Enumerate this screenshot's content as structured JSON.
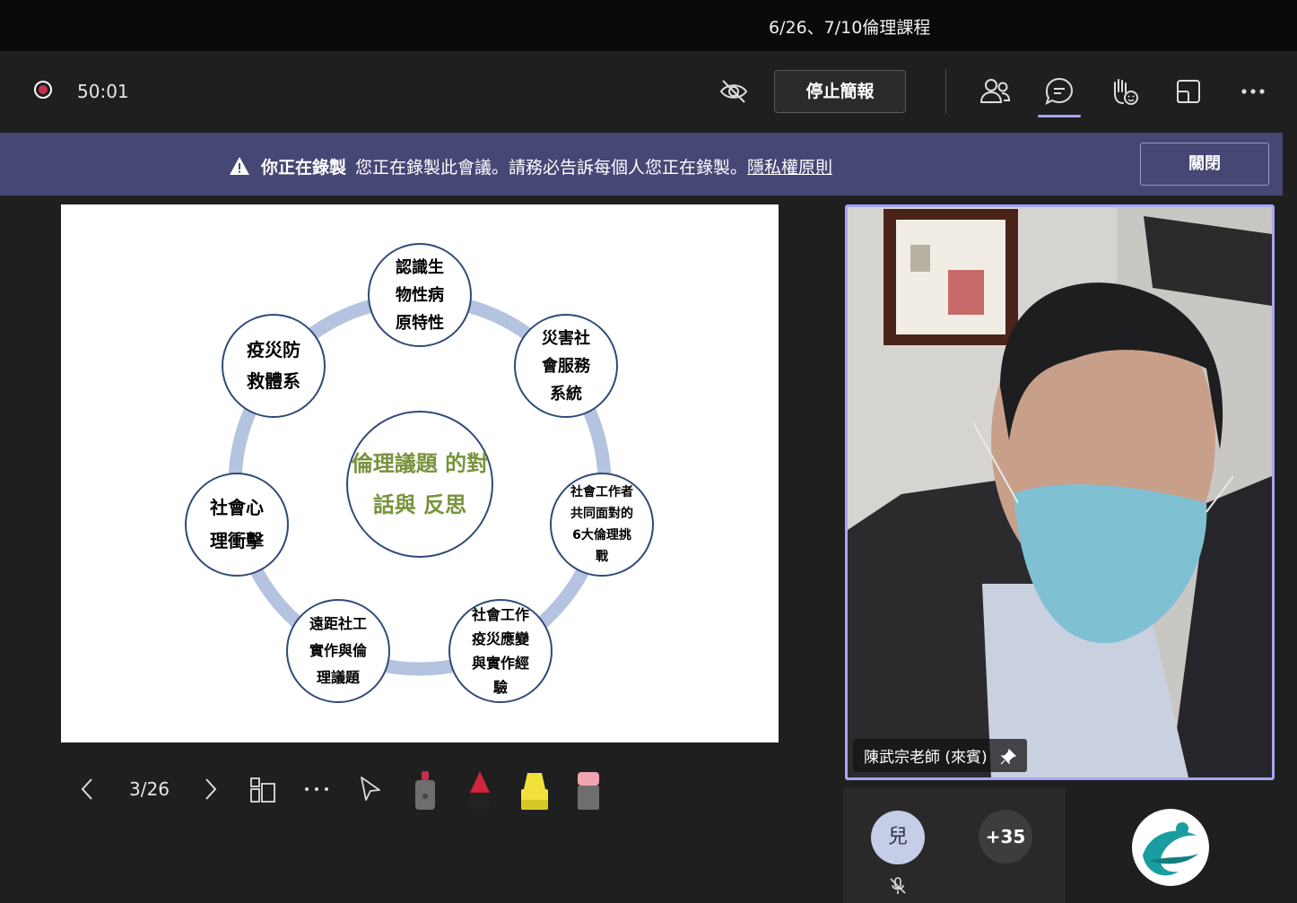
{
  "meeting": {
    "title": "6/26、7/10倫理課程",
    "timer": "50:01"
  },
  "toolbar": {
    "stop_presenting_label": "停止簡報"
  },
  "banner": {
    "heading": "你正在錄製",
    "message": "您正在錄製此會議。請務必告訴每個人您正在錄製。",
    "link": "隱私權原則",
    "close_label": "關閉"
  },
  "slide": {
    "center": [
      "倫理議題",
      "的對話與",
      "反思"
    ],
    "nodes": [
      {
        "lines": [
          "認識生",
          "物性病",
          "原特性"
        ]
      },
      {
        "lines": [
          "災害社",
          "會服務",
          "系統"
        ]
      },
      {
        "lines": [
          "社會工作者",
          "共同面對的",
          "6大倫理挑",
          "戰"
        ]
      },
      {
        "lines": [
          "社會工作",
          "疫災應變",
          "與實作經",
          "驗"
        ]
      },
      {
        "lines": [
          "遠距社工",
          "實作與倫",
          "理議題"
        ]
      },
      {
        "lines": [
          "社會心",
          "理衝擊"
        ]
      },
      {
        "lines": [
          "疫災防",
          "救體系"
        ]
      }
    ],
    "ring_color": "#b4c3e0"
  },
  "slide_controls": {
    "page": "3/26"
  },
  "video": {
    "name": "陳武宗老師 (來賓)"
  },
  "participants": {
    "avatar_initial": "兒",
    "overflow_count": "+35"
  },
  "colors": {
    "accent": "#a6a7f5",
    "banner_bg": "#464775",
    "record_red": "#c4314b",
    "center_text": "#77933c"
  }
}
